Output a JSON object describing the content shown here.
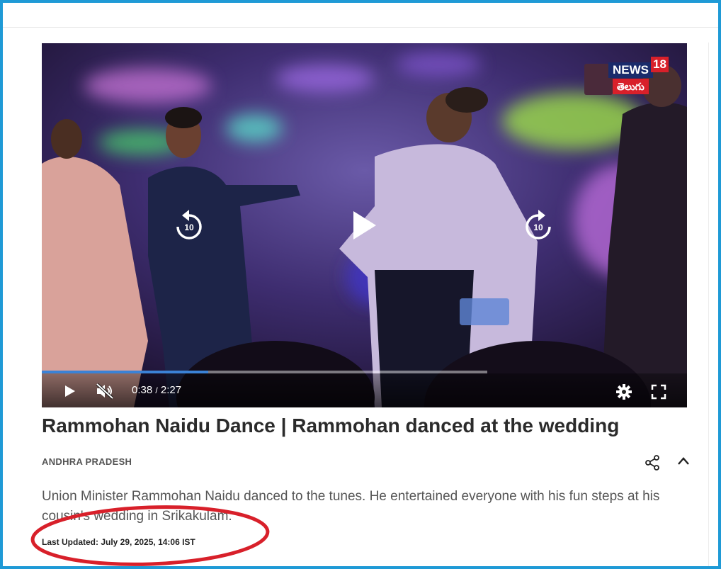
{
  "player": {
    "watermark_news": "NEWS",
    "watermark_number": "18",
    "watermark_language": "తెలుగు",
    "skip_back_label": "10",
    "skip_forward_label": "10",
    "current_time": "0:38",
    "time_separator": "/",
    "duration": "2:27",
    "progress_fraction": 0.258,
    "buffered_fraction": 0.69,
    "muted": true,
    "icons": [
      "play-icon",
      "replay-10-icon",
      "forward-10-icon",
      "volume-muted-icon",
      "settings-gear-icon",
      "fullscreen-icon"
    ],
    "accent_color": "#3b82d6"
  },
  "article": {
    "headline": "Rammohan Naidu Dance | Rammohan danced at the wedding",
    "category": "ANDHRA PRADESH",
    "summary": "Union Minister Rammohan Naidu danced to the tunes. He entertained everyone with his fun steps at his cousin's wedding in Srikakulam.",
    "last_updated": "Last Updated: July 29, 2025, 14:06 IST",
    "actions": [
      "share-icon",
      "chevron-up-icon"
    ]
  },
  "annotation": {
    "color": "#d8202a"
  },
  "frame": {
    "border_color": "#1f9ad6"
  }
}
